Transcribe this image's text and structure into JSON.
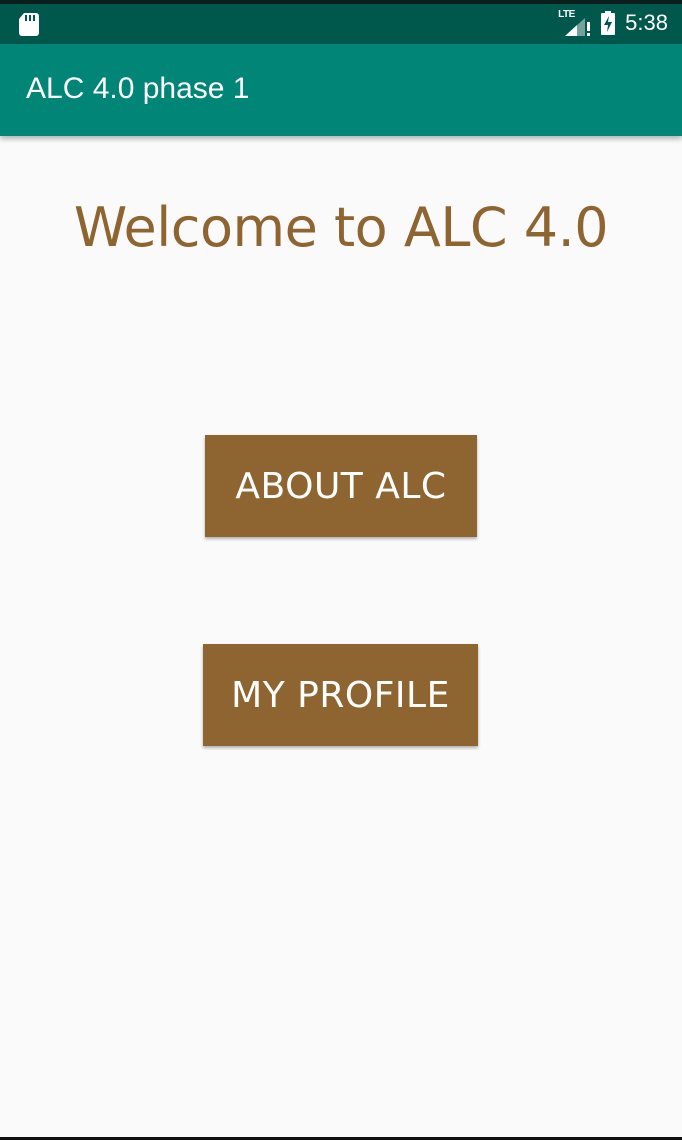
{
  "status_bar": {
    "time": "5:38",
    "network_label": "LTE",
    "icons": [
      "sd-card-icon",
      "lte-signal-icon",
      "battery-charging-icon"
    ]
  },
  "app_bar": {
    "title": "ALC 4.0 phase 1"
  },
  "main": {
    "welcome_text": "Welcome to ALC 4.0",
    "about_button_label": "ABOUT ALC",
    "profile_button_label": "MY PROFILE"
  },
  "colors": {
    "status_bar": "#00574b",
    "app_bar": "#008577",
    "accent_brown": "#8e6430",
    "background": "#fafafa"
  }
}
